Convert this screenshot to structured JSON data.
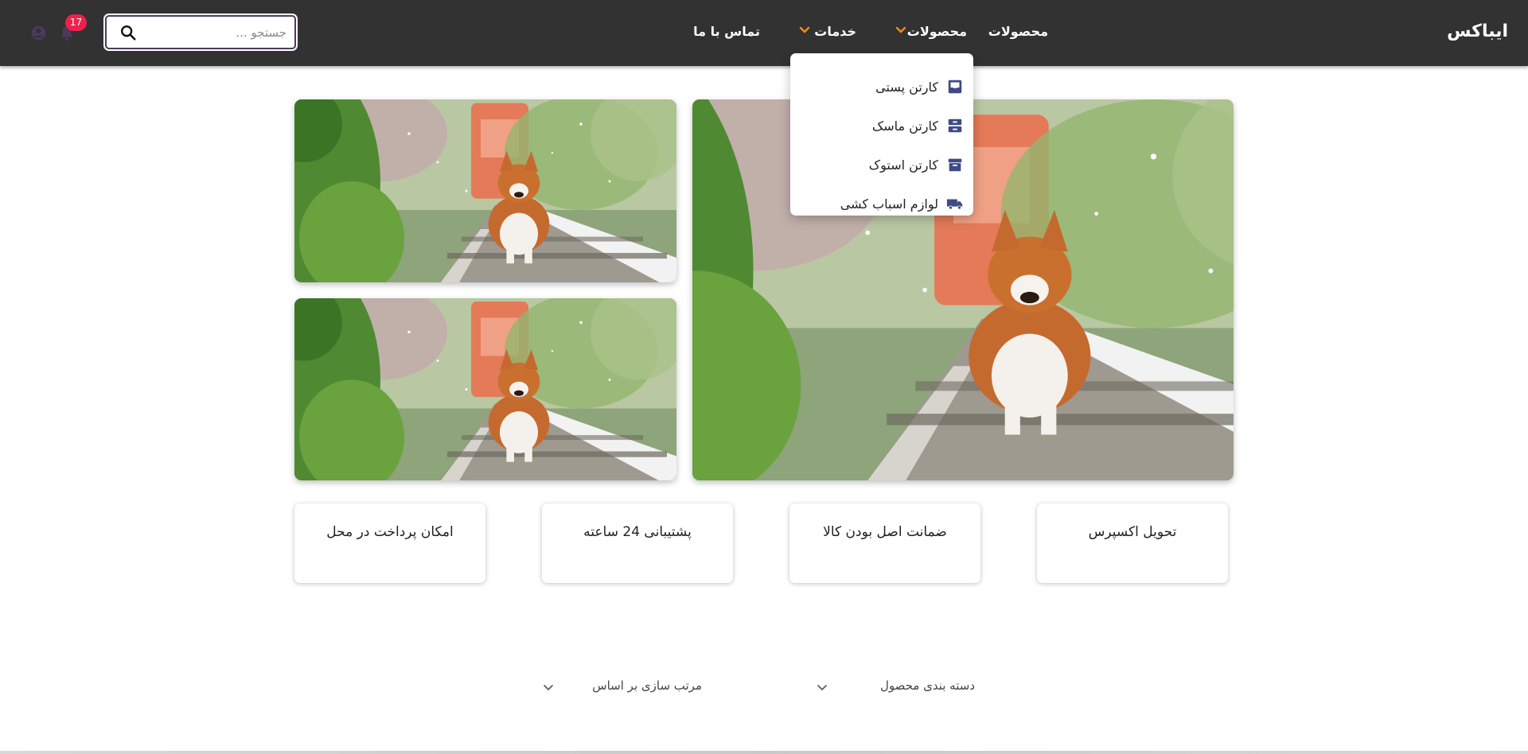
{
  "header": {
    "logo": "ایباکس",
    "nav": {
      "products_plain": "محصولات",
      "products_menu": "محصولات",
      "services_menu": "خدمات",
      "contact": "تماس با ما"
    },
    "search": {
      "placeholder": "جستجو ..."
    },
    "notifications": {
      "count": "17"
    },
    "accent_color": "#f08a24",
    "badge_color": "#f0204c"
  },
  "dropdown": {
    "items": [
      {
        "label": "کارتن پستی",
        "icon": "inbox-icon"
      },
      {
        "label": "کارتن ماسک",
        "icon": "tray-icon"
      },
      {
        "label": "کارتن استوک",
        "icon": "archive-icon"
      },
      {
        "label": "لوازم اسباب کشی",
        "icon": "truck-icon"
      }
    ]
  },
  "hero": {
    "images": [
      "corgi-on-railway-photo",
      "corgi-on-railway-photo",
      "corgi-on-railway-photo"
    ]
  },
  "features": [
    {
      "label": "تحویل اکسپرس"
    },
    {
      "label": "ضمانت اصل بودن کالا"
    },
    {
      "label": "پشتیبانی 24 ساعته"
    },
    {
      "label": "امکان پرداخت در محل"
    }
  ],
  "filters": {
    "category": "دسته بندی محصول",
    "sort": "مرتب سازی بر اساس"
  }
}
